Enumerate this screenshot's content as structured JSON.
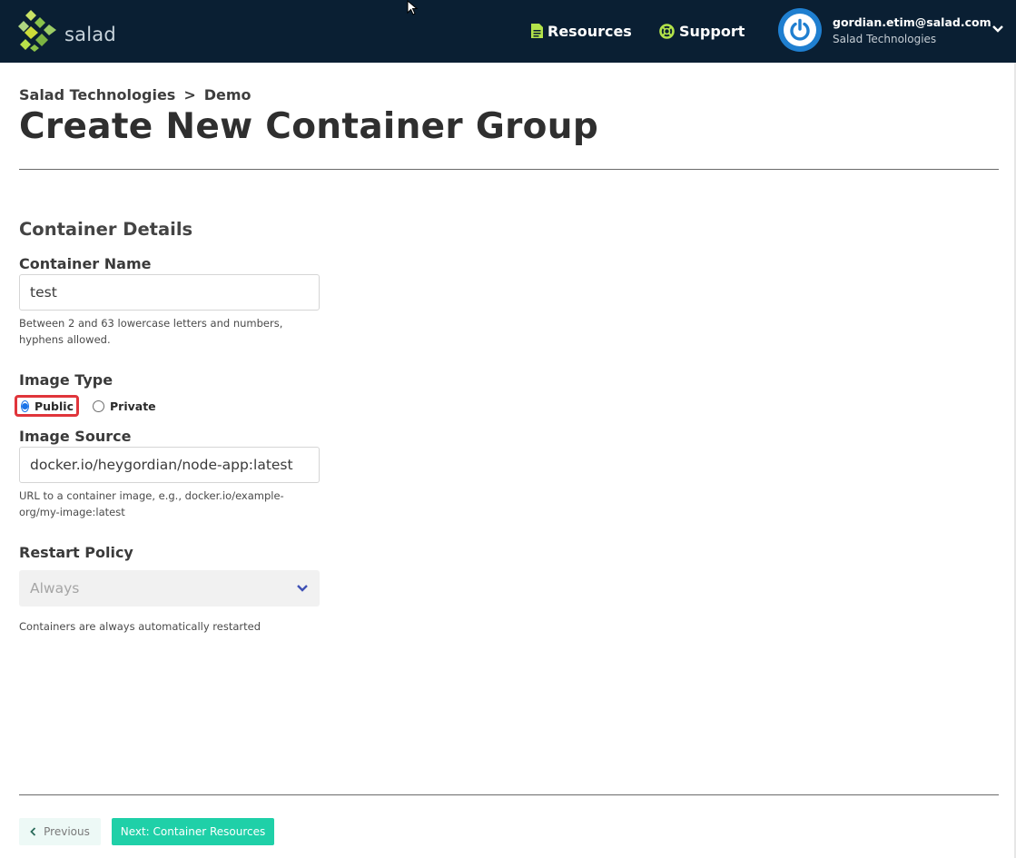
{
  "header": {
    "logo_text": "salad",
    "nav": [
      {
        "label": "Resources",
        "icon": "document-icon"
      },
      {
        "label": "Support",
        "icon": "lifebuoy-icon"
      }
    ],
    "user": {
      "email": "gordian.etim@salad.com",
      "organization": "Salad Technologies"
    }
  },
  "breadcrumb": {
    "org": "Salad Technologies",
    "separator": ">",
    "project": "Demo"
  },
  "page_title": "Create New Container Group",
  "section": {
    "title": "Container Details"
  },
  "container_name": {
    "label": "Container Name",
    "value": "test",
    "help": "Between 2 and 63 lowercase letters and numbers, hyphens allowed."
  },
  "image_type": {
    "label": "Image Type",
    "options": [
      "Public",
      "Private"
    ],
    "selected": "Public"
  },
  "image_source": {
    "label": "Image Source",
    "value": "docker.io/heygordian/node-app:latest",
    "help": "URL to a container image, e.g., docker.io/example-org/my-image:latest"
  },
  "restart_policy": {
    "label": "Restart Policy",
    "value": "Always",
    "help": "Containers are always automatically restarted"
  },
  "footer": {
    "previous_label": "Previous",
    "next_label": "Next: Container Resources"
  },
  "colors": {
    "topbar": "#0a1f33",
    "accent_green": "#b3e34a",
    "primary_button": "#1fd0a8",
    "highlight": "#e0353b",
    "avatar": "#1f7fd0"
  }
}
